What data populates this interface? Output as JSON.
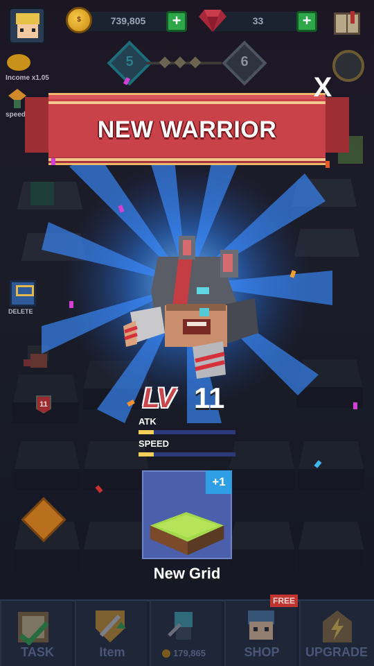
{
  "hud": {
    "coins": "739,805",
    "gems": "33",
    "current_level": "5",
    "next_level": "6",
    "income_label": "Income x1.05",
    "speed_label": "speed..."
  },
  "popup": {
    "title": "NEW WARRIOR",
    "close_label": "X",
    "level_prefix": "LV",
    "level_value": "11",
    "stats": [
      {
        "label": "ATK",
        "value": 0.16
      },
      {
        "label": "SPEED",
        "value": 0.16
      }
    ],
    "reward_badge": "+1",
    "reward_caption": "New Grid"
  },
  "board": {
    "delete_label": "DELETE",
    "warrior_level_badge": "11"
  },
  "nav": {
    "items": [
      {
        "label": "TASK"
      },
      {
        "label": "Item"
      },
      {
        "label": "",
        "sub": "179,865"
      },
      {
        "label": "SHOP",
        "tag": "FREE"
      },
      {
        "label": "UPGRADE"
      }
    ]
  },
  "colors": {
    "banner_red": "#c94249",
    "ray_blue": "#2f7ff0",
    "stat_fill": "#f4cf5a",
    "card_blue": "#4b5faa",
    "plus_green": "#2ea64a"
  }
}
